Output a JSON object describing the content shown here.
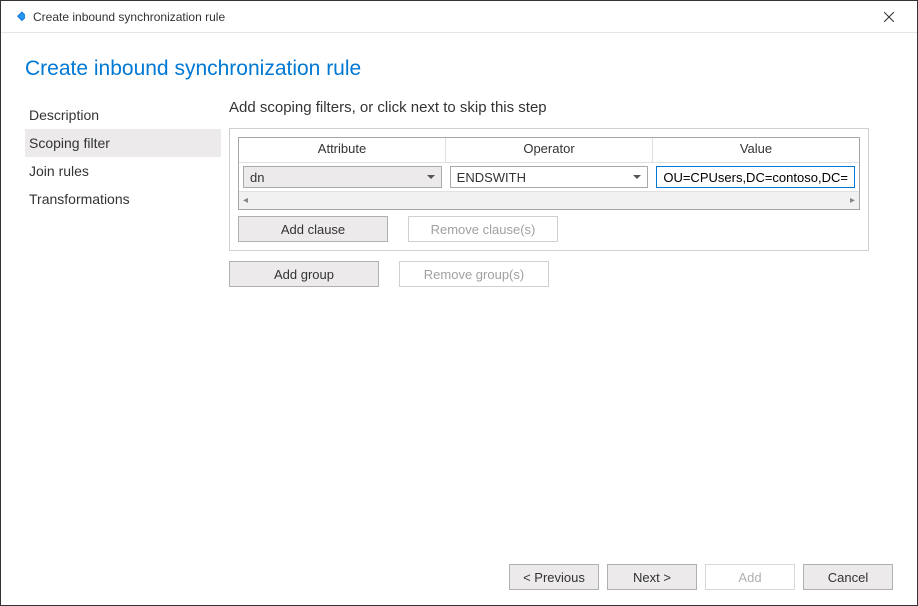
{
  "window": {
    "title": "Create inbound synchronization rule"
  },
  "page": {
    "heading": "Create inbound synchronization rule"
  },
  "sidebar": {
    "items": [
      {
        "label": "Description",
        "selected": false
      },
      {
        "label": "Scoping filter",
        "selected": true
      },
      {
        "label": "Join rules",
        "selected": false
      },
      {
        "label": "Transformations",
        "selected": false
      }
    ]
  },
  "main": {
    "instruction": "Add scoping filters, or click next to skip this step",
    "columns": {
      "attribute": "Attribute",
      "operator": "Operator",
      "value": "Value"
    },
    "row": {
      "attribute": "dn",
      "operator": "ENDSWITH",
      "value": "OU=CPUsers,DC=contoso,DC=com"
    },
    "buttons": {
      "add_clause": "Add clause",
      "remove_clause": "Remove clause(s)",
      "add_group": "Add group",
      "remove_group": "Remove group(s)"
    }
  },
  "footer": {
    "previous": "< Previous",
    "next": "Next >",
    "add": "Add",
    "cancel": "Cancel"
  }
}
